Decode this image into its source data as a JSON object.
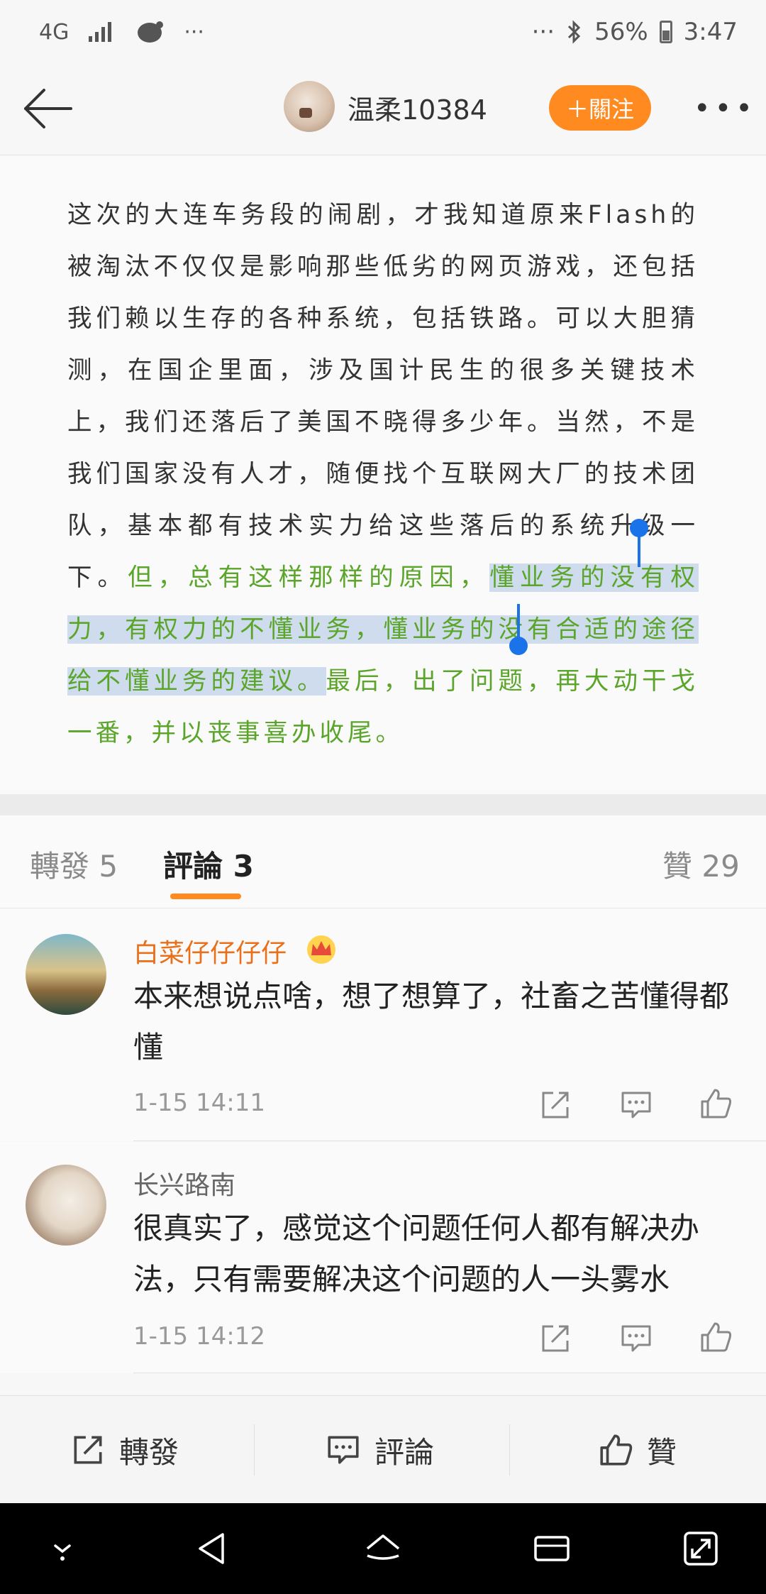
{
  "status_bar": {
    "network": "4G",
    "left_more": "···",
    "right_more": "···",
    "battery": "56%",
    "time": "3:47"
  },
  "header": {
    "username": "温柔10384",
    "follow_label": "＋關注"
  },
  "article": {
    "text_plain": "这次的大连车务段的闹剧，才我知道原来Flash的被淘汰不仅仅是影响那些低劣的网页游戏，还包括我们赖以生存的各种系统，包括铁路。可以大胆猜测，在国企里面，涉及国计民生的很多关键技术上，我们还落后了美国不晓得多少年。当然，不是我们国家没有人才，随便找个互联网大厂的技术团队，基本都有技术实力给这些落后的系统升级一下。",
    "text_green_1": "但，总有这样那样的原因，",
    "text_selected": "懂业务的没有权力，有权力的不懂业务，懂业务的没有合适的途径给不懂业务的建议。",
    "text_green_2": "最后，出了问题，再大动干戈一番，并以丧事喜办收尾。"
  },
  "tabs": {
    "repost": "轉發 5",
    "comments": "評論 3",
    "likes": "贊 29"
  },
  "comments": [
    {
      "name": "白菜仔仔仔仔",
      "name_color": "#e8701a",
      "text": "本来想说点啥，想了想算了，社畜之苦懂得都懂",
      "time": "1-15 14:11"
    },
    {
      "name": "长兴路南",
      "name_color": "#666666",
      "text": "很真实了，感觉这个问题任何人都有解决办法，只有需要解决这个问题的人一头雾水",
      "time": "1-15 14:12"
    }
  ],
  "bottom_bar": {
    "repost": "轉發",
    "comment": "評論",
    "like": "贊"
  },
  "colors": {
    "accent_orange": "#ff8a1f",
    "highlight_green": "#5aa52a",
    "selection_blue": "#cfdcee",
    "handle_blue": "#1a73e8"
  },
  "icons": [
    "back-arrow-icon",
    "more-icon",
    "crown-badge-icon",
    "share-icon",
    "comment-icon",
    "like-icon",
    "nav-down-icon",
    "nav-back-icon",
    "nav-home-icon",
    "nav-recents-icon",
    "nav-expand-icon"
  ]
}
